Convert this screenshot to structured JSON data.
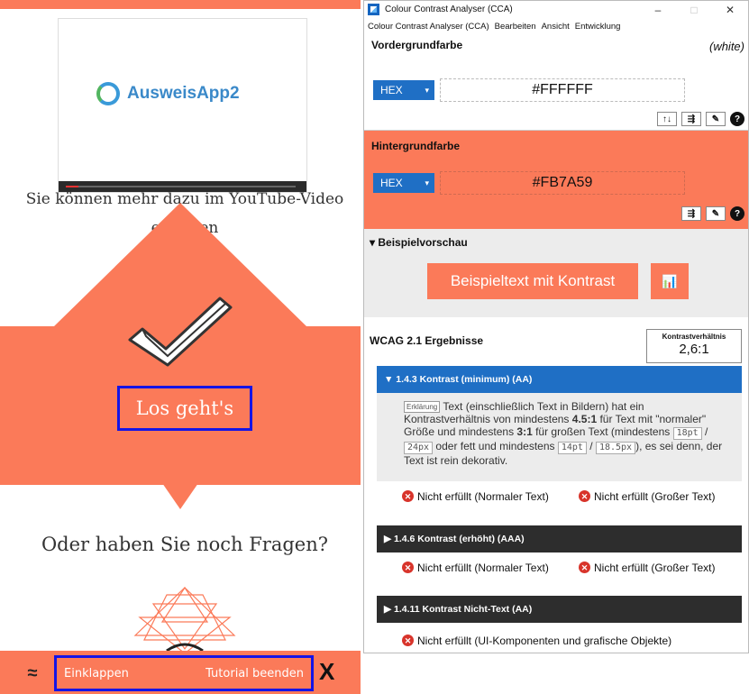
{
  "left": {
    "video_logo_text": "AusweisApp2",
    "video_text": "Sie können mehr dazu im YouTube-Video erfahren",
    "primary_button": "Los geht's",
    "questions_text": "Oder haben Sie noch Fragen?",
    "bottom_bar": {
      "collapse_label": "Einklappen",
      "end_label": "Tutorial beenden",
      "collapse_glyph": "≈",
      "close_glyph": "X"
    },
    "colors": {
      "accent": "#fb7a59",
      "highlight_border": "#1414e6"
    }
  },
  "cca": {
    "title": "Colour Contrast Analyser (CCA)",
    "window_buttons": {
      "minimize": "–",
      "maximize": "□",
      "close": "✕"
    },
    "menu": [
      "Colour Contrast Analyser (CCA)",
      "Bearbeiten",
      "Ansicht",
      "Entwicklung"
    ],
    "foreground": {
      "label": "Vordergrundfarbe",
      "note": "(white)",
      "format": "HEX",
      "value": "#FFFFFF",
      "tools": [
        "↑↓",
        "⇶",
        "✎",
        "?"
      ]
    },
    "background": {
      "label": "Hintergrundfarbe",
      "format": "HEX",
      "value": "#FB7A59",
      "tools": [
        "⇶",
        "✎",
        "?"
      ]
    },
    "preview": {
      "heading": "▾ Beispielvorschau",
      "sample_text": "Beispieltext mit Kontrast",
      "sample_icon": "📊"
    },
    "results": {
      "heading": "WCAG 2.1 Ergebnisse",
      "ratio_label": "Kontrastverhältnis",
      "ratio_value": "2,6:1",
      "criteria": [
        {
          "title": "▼ 1.4.3 Kontrast (minimum) (AA)",
          "explain_label": "Erklärung",
          "desc_1": " Text (einschließlich Text in Bildern) hat ein Kontrastverhältnis von mindestens ",
          "desc_b1": "4.5:1",
          "desc_2": " für Text mit \"normaler\" Größe und mindestens ",
          "desc_b2": "3:1",
          "desc_3": " für großen Text (mindestens ",
          "code_1": "18pt",
          "slash_1": " / ",
          "code_2": "24px",
          "desc_4": " oder fett und mindestens ",
          "code_3": "14pt",
          "slash_2": " / ",
          "code_4": "18.5px",
          "desc_5": "), es sei denn, der Text ist rein dekorativ.",
          "result_normal": "Nicht erfüllt (Normaler Text)",
          "result_large": "Nicht erfüllt (Großer Text)"
        },
        {
          "title": "▶ 1.4.6 Kontrast (erhöht) (AAA)",
          "result_normal": "Nicht erfüllt (Normaler Text)",
          "result_large": "Nicht erfüllt (Großer Text)"
        },
        {
          "title": "▶ 1.4.11 Kontrast Nicht-Text (AA)",
          "result": "Nicht erfüllt (UI-Komponenten und grafische Objekte)"
        }
      ]
    },
    "colors": {
      "blue": "#1f6fc5",
      "fail_red": "#d8342b",
      "dark_header": "#2d2d2d"
    }
  }
}
